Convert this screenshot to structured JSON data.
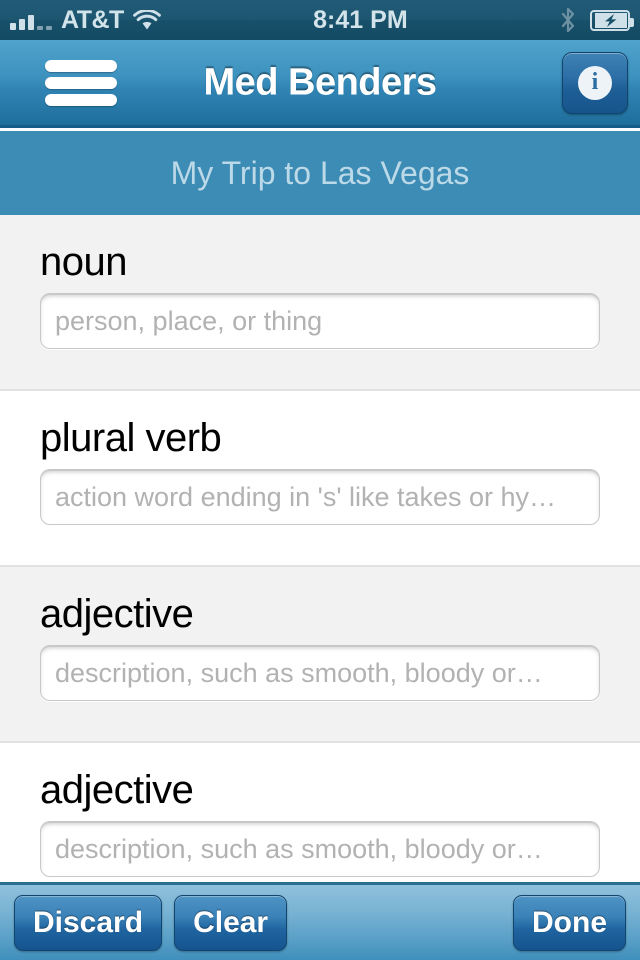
{
  "status_bar": {
    "carrier": "AT&T",
    "time": "8:41 PM",
    "signal_icon": "signal-bars-icon",
    "wifi_icon": "wifi-icon",
    "bluetooth_icon": "bluetooth-icon",
    "battery_icon": "battery-charging-icon",
    "signal_bars_filled": 3,
    "signal_bars_empty": 2
  },
  "nav": {
    "title": "Med Benders",
    "menu_icon": "hamburger-menu-icon",
    "info_icon": "info-icon",
    "info_glyph": "i"
  },
  "subtitle": {
    "text": "My Trip to Las Vegas"
  },
  "form": {
    "fields": [
      {
        "label": "noun",
        "placeholder": "person, place, or thing",
        "value": ""
      },
      {
        "label": "plural verb",
        "placeholder": "action word ending in 's' like takes or hy…",
        "value": ""
      },
      {
        "label": "adjective",
        "placeholder": "description, such as smooth, bloody or…",
        "value": ""
      },
      {
        "label": "adjective",
        "placeholder": "description, such as smooth, bloody or…",
        "value": ""
      }
    ]
  },
  "toolbar": {
    "discard_label": "Discard",
    "clear_label": "Clear",
    "done_label": "Done"
  },
  "colors": {
    "status_bar_bg": "#1a5269",
    "nav_bar_top": "#4fa3cc",
    "nav_bar_bottom": "#1f6e9c",
    "subtitle_bg": "#3d8cb5",
    "subtitle_text": "#bcd9e8",
    "row_alt_bg": "#f2f2f2",
    "row_bg": "#ffffff",
    "label_text": "#000000",
    "placeholder_text": "#b2b2b2",
    "toolbar_top": "#8fc1dc",
    "toolbar_bottom": "#3f8fbc",
    "button_top": "#4e93c4",
    "button_bottom": "#15538e",
    "button_text": "#ffffff"
  }
}
